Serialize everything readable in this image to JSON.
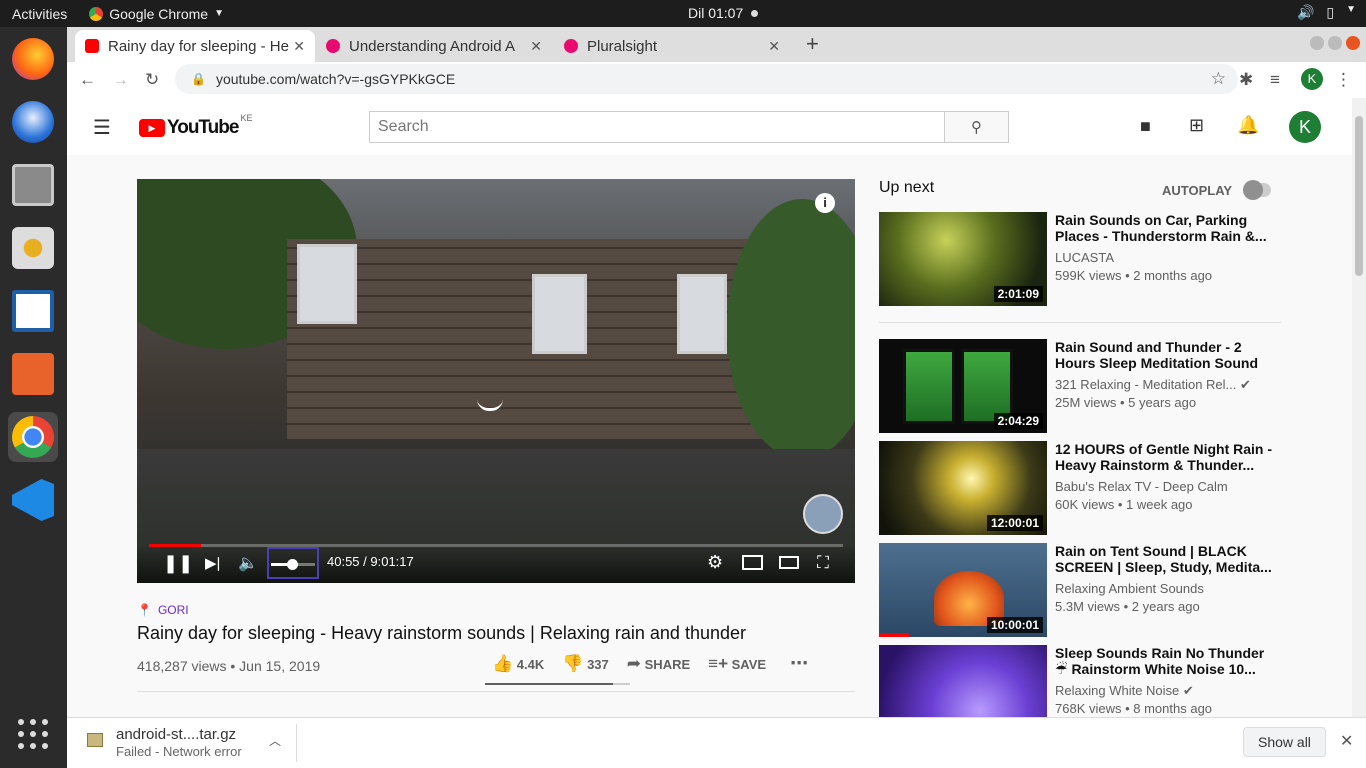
{
  "os": {
    "activities": "Activities",
    "app_name": "Google Chrome",
    "clock": "Dil 01:07"
  },
  "tabs": [
    {
      "label": "Rainy day for sleeping - He",
      "close": "✕"
    },
    {
      "label": "Understanding Android A",
      "close": "✕"
    },
    {
      "label": "Pluralsight",
      "close": "✕"
    }
  ],
  "new_tab": "+",
  "url": "youtube.com/watch?v=-gsGYPKkGCE",
  "profile_initial": "K",
  "youtube": {
    "logo_text": "YouTube",
    "region": "KE",
    "search_placeholder": "Search"
  },
  "player": {
    "time": "40:55 / 9:01:17",
    "progress": 0.075,
    "volume": 0.5
  },
  "video": {
    "tag": "GORI",
    "title": "Rainy day for sleeping - Heavy rainstorm sounds | Relaxing rain and thunder",
    "stats": "418,287 views • Jun 15, 2019",
    "likes": "4.4K",
    "dislikes": "337",
    "share": "SHARE",
    "save": "SAVE"
  },
  "sidebar": {
    "up_next": "Up next",
    "autoplay": "AUTOPLAY",
    "videos": [
      {
        "title": "Rain Sounds on Car, Parking Places - Thunderstorm Rain &...",
        "channel": "LUCASTA",
        "meta": "599K views • 2 months ago",
        "duration": "2:01:09"
      },
      {
        "title": "Rain Sound and Thunder - 2 Hours Sleep Meditation Sound",
        "channel": "321 Relaxing - Meditation Rel...",
        "meta": "25M views • 5 years ago",
        "duration": "2:04:29"
      },
      {
        "title": "12 HOURS of Gentle Night Rain - Heavy Rainstorm & Thunder...",
        "channel": "Babu's Relax TV - Deep Calm",
        "meta": "60K views • 1 week ago",
        "duration": "12:00:01"
      },
      {
        "title": "Rain on Tent Sound | BLACK SCREEN | Sleep, Study, Medita...",
        "channel": "Relaxing Ambient Sounds",
        "meta": "5.3M views • 2 years ago",
        "duration": "10:00:01"
      },
      {
        "title": "Sleep Sounds Rain No Thunder ☔ Rainstorm White Noise 10...",
        "channel": "Relaxing White Noise",
        "meta": "768K views • 8 months ago",
        "duration": ""
      }
    ]
  },
  "download": {
    "filename": "android-st....tar.gz",
    "status": "Failed - Network error",
    "show_all": "Show all"
  }
}
